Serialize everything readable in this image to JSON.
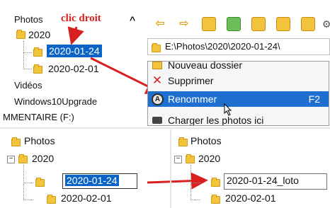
{
  "top_panel": {
    "tree": {
      "root": "Photos",
      "year": "2020",
      "item_selected": "2020-01-24",
      "item_other": "2020-02-01",
      "videos": "Vidéos",
      "upgrade": "Windows10Upgrade",
      "drive": "MMENTAIRE (F:)"
    },
    "annotation": "clic droit",
    "address": "E:\\Photos\\2020\\2020-01-24\\",
    "context_menu": {
      "items": [
        {
          "label": "Nouveau dossier",
          "icon": "new-folder-icon"
        },
        {
          "label": "Supprimer",
          "icon": "delete-x-icon"
        },
        {
          "label": "Renommer",
          "shortcut": "F2",
          "icon": "rename-icon",
          "highlighted": true
        },
        {
          "label": "Charger les photos ici",
          "icon": "camera-icon"
        }
      ]
    }
  },
  "bottom_left": {
    "root": "Photos",
    "year": "2020",
    "editing_value": "2020-01-24",
    "other": "2020-02-01"
  },
  "bottom_right": {
    "root": "Photos",
    "year": "2020",
    "renamed_value": "2020-01-24_loto",
    "other": "2020-02-01"
  },
  "colors": {
    "selection": "#0a64c8",
    "menu_highlight": "#1f6fd1",
    "annotation": "#d82020",
    "folder": "#f2c33c"
  }
}
